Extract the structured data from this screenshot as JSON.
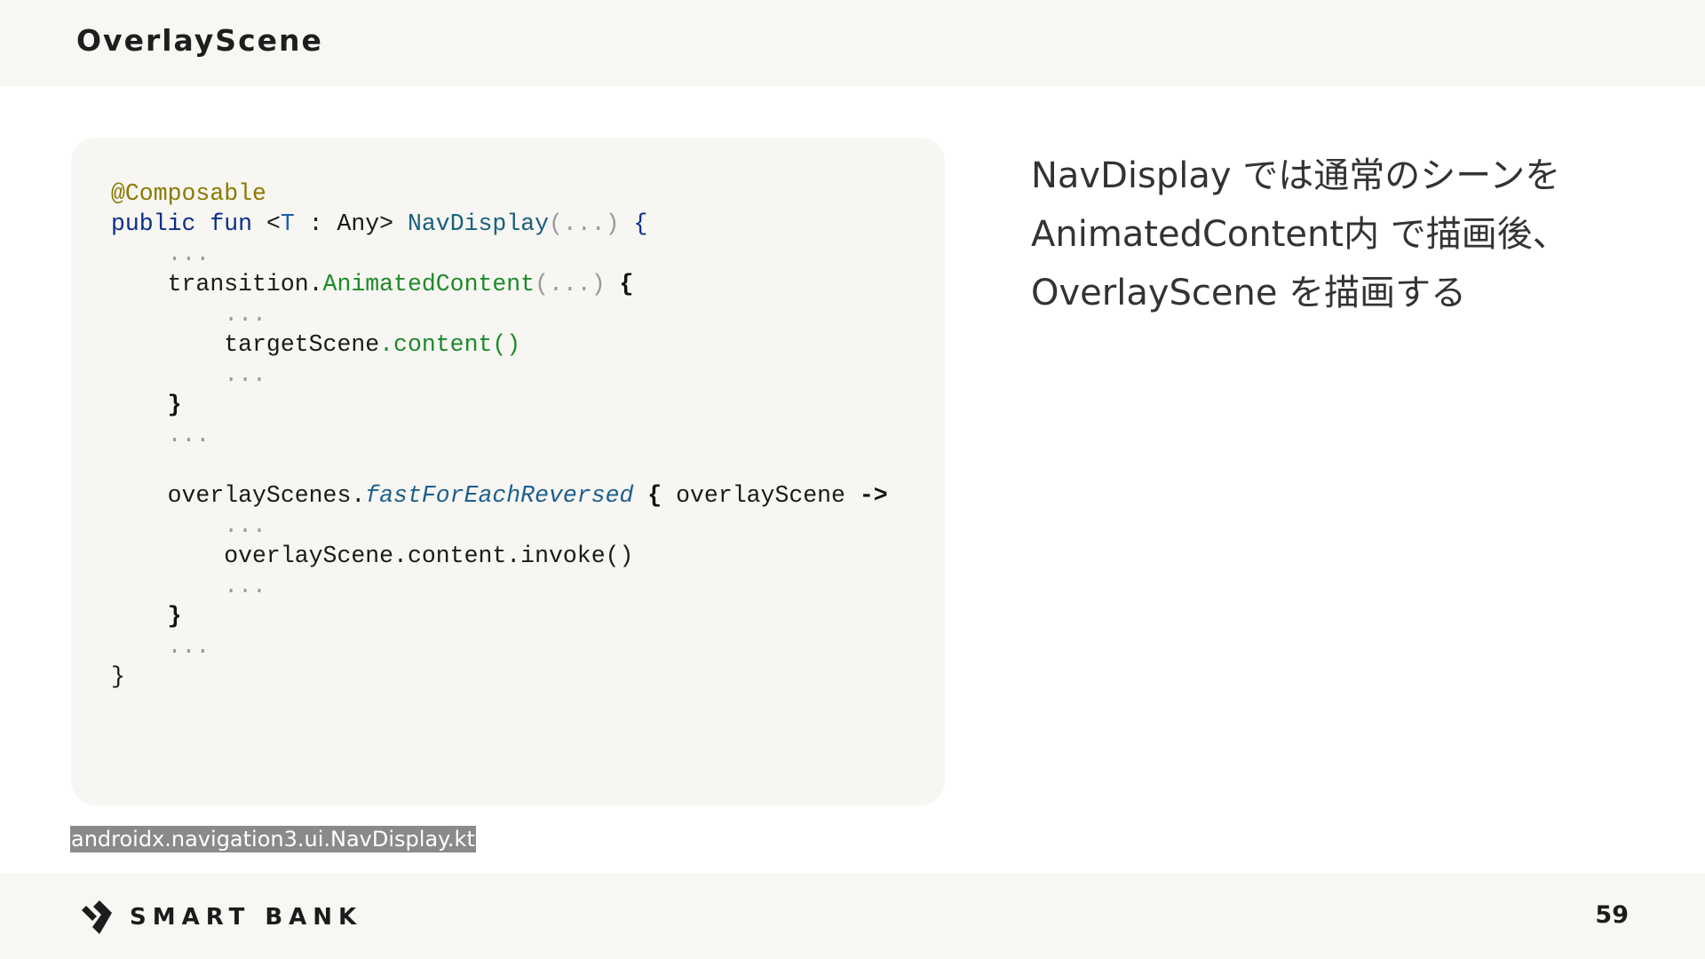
{
  "slide": {
    "title": "OverlayScene",
    "page_number": "59"
  },
  "code": {
    "lines": [
      [
        {
          "t": "@Composable",
          "c": "ann"
        }
      ],
      [
        {
          "t": "public",
          "c": "kw"
        },
        {
          "t": " "
        },
        {
          "t": "fun",
          "c": "kw"
        },
        {
          "t": " <"
        },
        {
          "t": "T",
          "c": "tp"
        },
        {
          "t": " : Any> "
        },
        {
          "t": "NavDisplay",
          "c": "fn"
        },
        {
          "t": "(...)",
          "c": "dim"
        },
        {
          "t": " {",
          "c": "kw"
        }
      ],
      [
        {
          "t": "    "
        },
        {
          "t": "...",
          "c": "dim"
        }
      ],
      [
        {
          "t": "    transition."
        },
        {
          "t": "AnimatedContent",
          "c": "call"
        },
        {
          "t": "(...)",
          "c": "dim"
        },
        {
          "t": " {",
          "c": "bold"
        }
      ],
      [
        {
          "t": "        "
        },
        {
          "t": "...",
          "c": "dim"
        }
      ],
      [
        {
          "t": "        targetScene"
        },
        {
          "t": ".content()",
          "c": "call"
        }
      ],
      [
        {
          "t": "        "
        },
        {
          "t": "...",
          "c": "dim"
        }
      ],
      [
        {
          "t": "    "
        },
        {
          "t": "}",
          "c": "bold"
        }
      ],
      [
        {
          "t": "    "
        },
        {
          "t": "...",
          "c": "dim"
        }
      ],
      [
        {
          "t": ""
        }
      ],
      [
        {
          "t": "    overlayScenes."
        },
        {
          "t": "fastForEachReversed",
          "c": "ext"
        },
        {
          "t": " { ",
          "c": "bold"
        },
        {
          "t": "overlayScene "
        },
        {
          "t": "->",
          "c": "bold"
        }
      ],
      [
        {
          "t": "        "
        },
        {
          "t": "...",
          "c": "dim"
        }
      ],
      [
        {
          "t": "        overlayScene.content.invoke()"
        }
      ],
      [
        {
          "t": "        "
        },
        {
          "t": "...",
          "c": "dim"
        }
      ],
      [
        {
          "t": "    "
        },
        {
          "t": "}",
          "c": "bold"
        }
      ],
      [
        {
          "t": "    "
        },
        {
          "t": "...",
          "c": "dim"
        }
      ],
      [
        {
          "t": "}"
        }
      ]
    ]
  },
  "description": {
    "lines": [
      "NavDisplay では通常のシーンを",
      "AnimatedContent内 で描画後、",
      "OverlayScene を描画する"
    ]
  },
  "source_label": "androidx.navigation3.ui.NavDisplay.kt",
  "brand": {
    "name": "SMART BANK",
    "logo_icon": "smartbank-logo-icon"
  }
}
